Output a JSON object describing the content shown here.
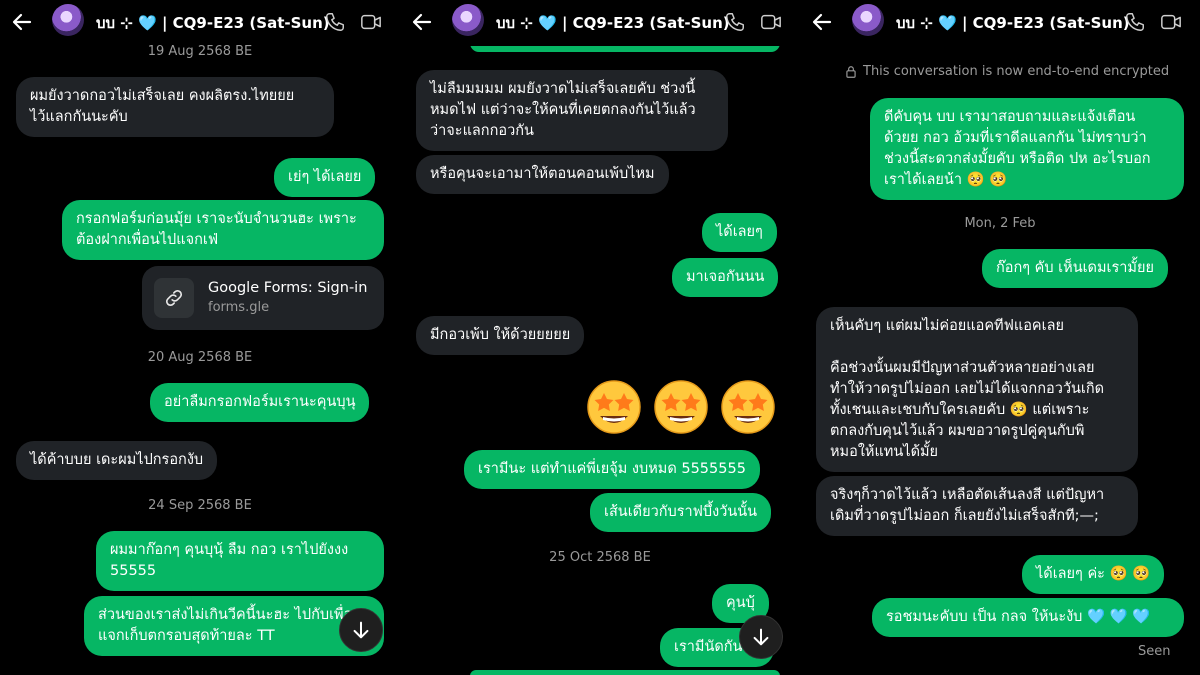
{
  "chat_title": "บบ ⊹ 🩵 | CQ9-E23 (Sat-Sun)",
  "colors": {
    "outgoing": "#06b664",
    "incoming": "#202327",
    "background": "#000000",
    "accent_heart": "#6ec6ff"
  },
  "icons": {
    "back": "arrow-left-icon",
    "call": "phone-icon",
    "video": "video-icon",
    "scroll": "arrow-down-icon",
    "link": "link-icon",
    "lock": "lock-icon"
  },
  "p1": {
    "date1": "19 Aug 2568 BE",
    "m1": "ผมยังวาดกอวไม่เสร็จเลย คงผลิตรง.ไทยยย\nไว้แลกกันนะคับ",
    "m2": "เย่ๆ ได้เลยย",
    "m3": "กรอกฟอร์มก่อนมุ้ย เราจะนับจำนวนฮะ เพราะ\nต้องฝากเพื่อนไปแจกเฟ่",
    "card_title": "Google Forms: Sign-in",
    "card_url": "forms.gle",
    "date2": "20 Aug 2568 BE",
    "m4": "อย่าลืมกรอกฟอร์มเรานะคุนบุนุ",
    "m5": "ได้ค้าบบย เดะผมไปกรอกงับ",
    "date3": "24 Sep 2568 BE",
    "m6": "ผมมาก๊อกๆ คุนบุนุ้ ลืม กอว เราไปยังงง\n55555",
    "m7": "ส่วนของเราส่งไม่เกินวีคนี้นะฮะ ไปกับเพื่อน\nแจกเก็บตกรอบสุดท้ายละ TT"
  },
  "p2": {
    "m1": "ไม่ลืมมมมม ผมยังวาดไม่เสร็จเลยคับ ช่วงนี้\nหมดไฟ แต่ว่าจะให้คนที่เคยตกลงกันไว้แล้ว\nว่าจะแลกกอวกัน",
    "m2": "หรือคุนจะเอามาให้ตอนคอนเพ้บไหม",
    "m3": "ได้เลยๆ",
    "m4": "มาเจอกันนน",
    "m5": "มีกอวเพ้บ ให้ด้วยยยยย",
    "emoji_name": "star-struck-emoji",
    "emoji_count": 3,
    "m6": "เรามีนะ แต่ทำแค่พี่เยจุ้ม งบหมด 5555555",
    "m7": "เส้นเดียวกับราฟบึ้งวันนั้น",
    "date1": "25 Oct 2568 BE",
    "m8": "คุนบุ้",
    "m9": "เรามีนัดกันนะ"
  },
  "p3": {
    "encrypted": "This conversation is now end-to-end encrypted",
    "m1": "ดีคับคุน บบ เรามาสอบถามและแจ้งเตือน\nด้วยย กอว อ้วมที่เราดีลแลกกัน ไม่ทราบว่า\nช่วงนี้สะดวกส่งมั้ยคับ หรือติด ปห อะไรบอก\nเราได้เลยน้า 🥺 🥺",
    "date1": "Mon, 2 Feb",
    "m2": "ก๊อกๆ คับ เห็นเดมเรามั้ยย",
    "m3": "เห็นคับๆ แต่ผมไม่ค่อยแอคทีฟแอคเลย\n\nคือช่วงนั้นผมมีปัญหาส่วนตัวหลายอย่างเลย\nทำให้วาดรูปไม่ออก เลยไม่ได้แจกกอววันเกิด\nทั้งเชนและเชบกับใครเลยคับ 🥺 แต่เพราะ\nตกลงกับคุนไว้แล้ว ผมขอวาดรูปคู่คุนกับพิ\nหมอให้แทนได้มั้ย",
    "m4": "จริงๆก็วาดไว้แล้ว เหลือตัดเส้นลงสี แต่ปัญหา\nเดิมที่วาดรูปไม่ออก ก็เลยยังไม่เสร็จสักที;—;",
    "m5": "ได้เลยๆ ค่ะ 🥺 🥺",
    "m6": "รอชมนะคับบ เป็น กลจ ให้นะงับ 🩵 🩵 🩵",
    "seen": "Seen"
  }
}
